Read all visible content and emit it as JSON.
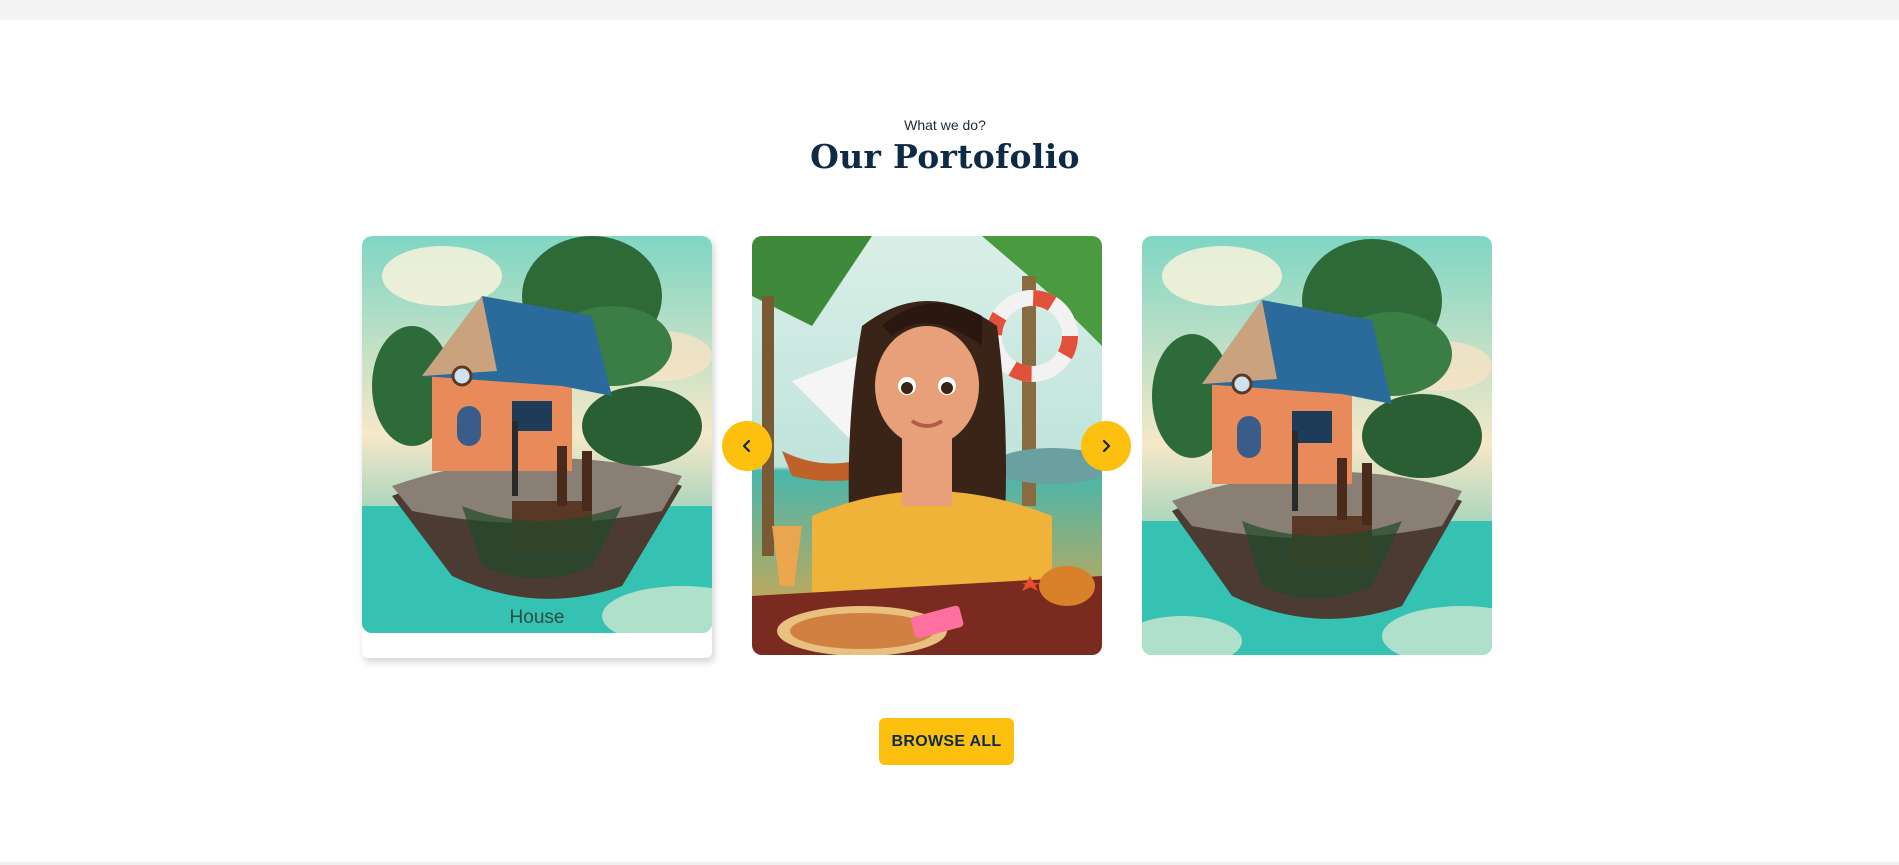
{
  "header": {
    "subtitle": "What we do?",
    "title": "Our Portofolio"
  },
  "portfolio": {
    "items": [
      {
        "caption": "House",
        "image": "island-house-illustration"
      },
      {
        "caption": "",
        "image": "beach-girl-illustration"
      },
      {
        "caption": "",
        "image": "island-house-illustration"
      }
    ],
    "prev_icon": "chevron-left-icon",
    "next_icon": "chevron-right-icon"
  },
  "browse_button": {
    "label": "BROWSE ALL"
  },
  "colors": {
    "accent": "#fdc00f",
    "title": "#0f2a45",
    "background": "#ffffff"
  }
}
